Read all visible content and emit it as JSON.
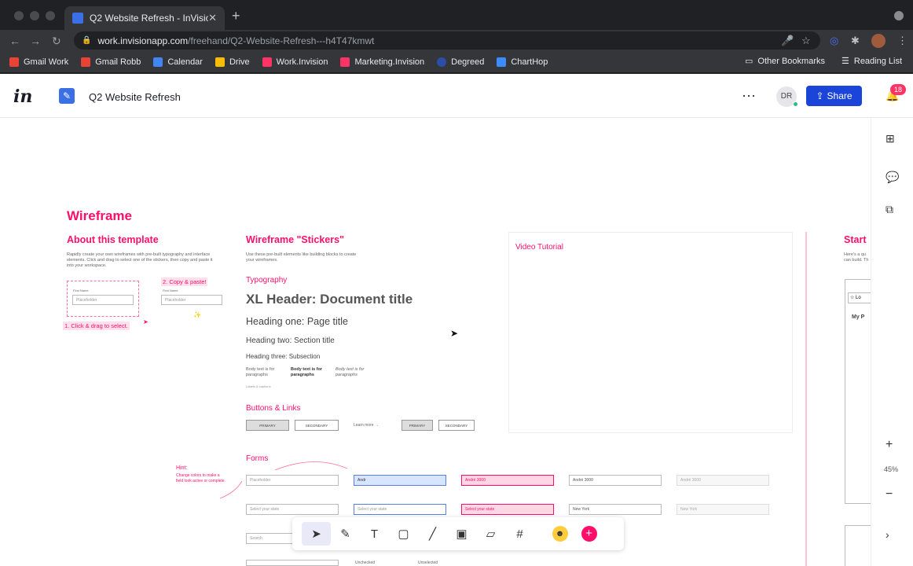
{
  "browser": {
    "tab_title": "Q2 Website Refresh - InVision",
    "new_tab": "+",
    "url_host": "work.invisionapp.com",
    "url_path": "/freehand/Q2-Website-Refresh---h4T47kmwt",
    "bookmarks": [
      {
        "label": "Gmail Work",
        "color": "#ea4335"
      },
      {
        "label": "Gmail Robb",
        "color": "#ea4335"
      },
      {
        "label": "Calendar",
        "color": "#4285f4"
      },
      {
        "label": "Drive",
        "color": "#fbbc04"
      },
      {
        "label": "Work.Invision",
        "color": "#ff3366"
      },
      {
        "label": "Marketing.Invision",
        "color": "#ff3366"
      },
      {
        "label": "Degreed",
        "color": "#2d4ea6"
      },
      {
        "label": "ChartHop",
        "color": "#3d8bfd"
      }
    ],
    "other_bookmarks": "Other Bookmarks",
    "reading_list": "Reading List"
  },
  "app": {
    "logo": "in",
    "project_name": "Q2 Website Refresh",
    "user_initials": "DR",
    "share_label": "Share",
    "notification_count": "18",
    "zoom": "45%"
  },
  "board": {
    "title": "Wireframe",
    "about": {
      "heading": "About this template",
      "body": "Rapidly create your own wireframes with pre-built typography and interface elements. Click and drag to select one of the stickers, then copy and paste it into your workspace.",
      "step1": "1. Click & drag to select.",
      "step2": "2. Copy & paste!",
      "field_label": "First Name",
      "placeholder": "Placeholder"
    },
    "stickers": {
      "heading": "Wireframe \"Stickers\"",
      "body": "Use these pre-built elements like building blocks to create your wireframes.",
      "typography_label": "Typography",
      "xl": "XL Header: Document title",
      "h1": "Heading one: Page title",
      "h2": "Heading two: Section title",
      "h3": "Heading three: Subsection",
      "body1": "Body text is for paragraphs",
      "body2": "Body text is for paragraphs",
      "body3": "Body text is for paragraphs",
      "caption": "Labels & captions",
      "buttons_label": "Buttons & Links",
      "btn_primary": "PRIMARY",
      "btn_secondary": "SECONDARY",
      "link_learn": "Learn more →",
      "btn_primary_icon": "PRIMARY",
      "btn_secondary_icon": "SECONDARY",
      "forms_label": "Forms",
      "hint_title": "Hint:",
      "hint_body": "Change colors to make a field look active or complete.",
      "f1": "Placeholder",
      "f2": "Andr",
      "f3": "André 3000",
      "f4": "André 3000",
      "f5": "André 3000",
      "s1": "Select your state",
      "s2": "Select your state",
      "s3": "Select your state",
      "s4": "New York",
      "s5": "New York",
      "search": "Search",
      "unchecked1": "Unchecked",
      "unchecked2": "Unselected"
    },
    "video_label": "Video Tutorial",
    "start_label": "Start"
  }
}
